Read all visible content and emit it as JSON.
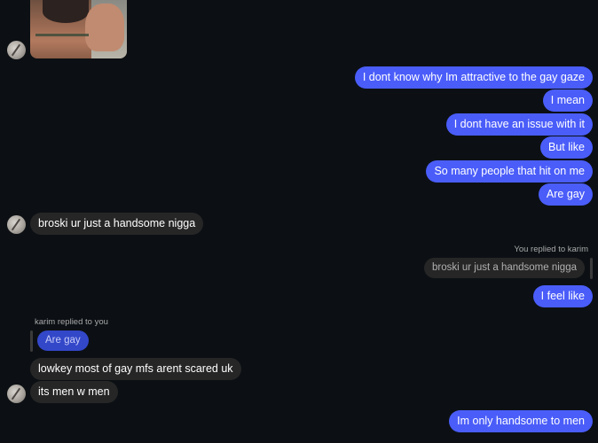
{
  "chat": {
    "contact_name": "karim",
    "messages": [
      {
        "id": "m1",
        "from": "me",
        "text": "I dont know why Im attractive to the gay gaze"
      },
      {
        "id": "m2",
        "from": "me",
        "text": "I mean"
      },
      {
        "id": "m3",
        "from": "me",
        "text": "I dont have an issue with it"
      },
      {
        "id": "m4",
        "from": "me",
        "text": "But like"
      },
      {
        "id": "m5",
        "from": "me",
        "text": "So many people that hit on me"
      },
      {
        "id": "m6",
        "from": "me",
        "text": "Are gay"
      },
      {
        "id": "m7",
        "from": "them",
        "text": "broski ur just a handsome nigga"
      },
      {
        "id": "m8",
        "from": "me",
        "reply_label": "You replied to karim",
        "quoted": "broski ur just a handsome nigga",
        "text": "I feel like"
      },
      {
        "id": "m9",
        "from": "them",
        "reply_label": "karim replied to you",
        "quoted": "Are gay",
        "text": "lowkey most of gay mfs arent scared uk"
      },
      {
        "id": "m10",
        "from": "them",
        "text": "its men w men"
      },
      {
        "id": "m11",
        "from": "me",
        "text": "Im only handsome to men"
      }
    ]
  },
  "colors": {
    "background": "#0c1014",
    "outgoing_bubble": "#4a5df9",
    "incoming_bubble": "#262626",
    "quoted_outgoing": "#3347c9"
  }
}
